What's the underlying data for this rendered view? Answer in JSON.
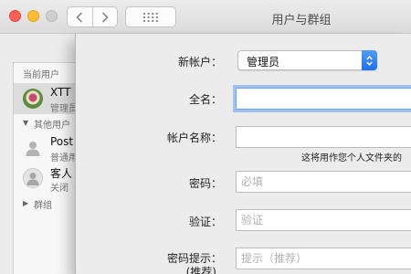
{
  "window": {
    "title": "用户与群组"
  },
  "sidebar": {
    "current_users_label": "当前用户",
    "current_user": {
      "name": "XTT",
      "role": "管理员"
    },
    "other_users_label": "其他用户",
    "other_users": [
      {
        "name": "Post",
        "sub": "普通用"
      },
      {
        "name": "客人",
        "sub": "关闭"
      }
    ],
    "groups_label": "群组"
  },
  "form": {
    "new_account": {
      "label": "新帐户：",
      "value": "管理员"
    },
    "full_name": {
      "label": "全名：",
      "value": "",
      "placeholder": ""
    },
    "account_name": {
      "label": "帐户名称：",
      "value": "",
      "placeholder": "",
      "hint": "这将用作您个人文件夹的"
    },
    "password": {
      "label": "密码：",
      "placeholder": "必填"
    },
    "verify": {
      "label": "验证：",
      "placeholder": "验证"
    },
    "password_hint": {
      "label": "密码提示：",
      "sublabel": "(推荐)",
      "placeholder": "提示（推荐）"
    }
  },
  "colors": {
    "accent": "#1f6ff0",
    "focus_ring": "#9ec2f4",
    "close": "#ff5f57",
    "minimize": "#febc2e"
  }
}
